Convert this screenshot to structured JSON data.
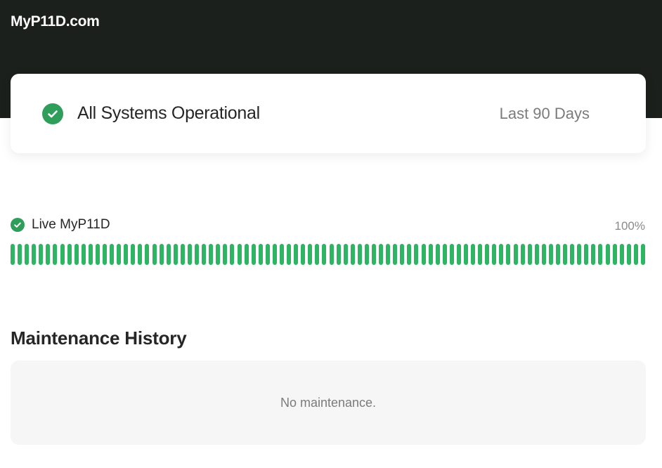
{
  "header": {
    "brand": "MyP11D.com"
  },
  "status": {
    "title": "All Systems Operational",
    "range_label": "Last 90 Days",
    "icon": "check-circle-icon",
    "color": "#2f9e5a"
  },
  "components": [
    {
      "name": "Live MyP11D",
      "uptime": "100%",
      "icon": "check-circle-icon",
      "days": 90,
      "bar_color": "#2fb463"
    }
  ],
  "maintenance": {
    "title": "Maintenance History",
    "empty_text": "No maintenance."
  }
}
